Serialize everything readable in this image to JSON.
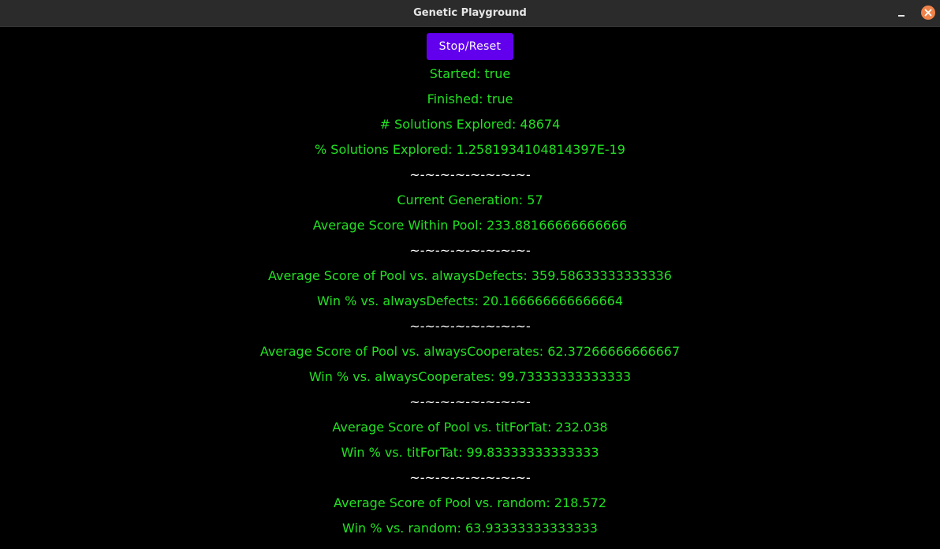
{
  "window": {
    "title": "Genetic Playground"
  },
  "controls": {
    "stop_reset_label": "Stop/Reset"
  },
  "status": {
    "started": "Started: true",
    "finished": "Finished: true",
    "solutions_explored": "# Solutions Explored: 48674",
    "percent_explored": "% Solutions Explored: 1.2581934104814397E-19"
  },
  "separator": "~-~-~-~-~-~-~-~-",
  "generation": {
    "current": "Current Generation: 57",
    "avg_within_pool": "Average Score Within Pool: 233.88166666666666"
  },
  "matchups": [
    {
      "avg_score": "Average Score of Pool vs. alwaysDefects: 359.58633333333336",
      "win_pct": "Win % vs. alwaysDefects: 20.166666666666664"
    },
    {
      "avg_score": "Average Score of Pool vs. alwaysCooperates: 62.37266666666667",
      "win_pct": "Win % vs. alwaysCooperates: 99.73333333333333"
    },
    {
      "avg_score": "Average Score of Pool vs. titForTat: 232.038",
      "win_pct": "Win % vs. titForTat: 99.83333333333333"
    },
    {
      "avg_score": "Average Score of Pool vs. random: 218.572",
      "win_pct": "Win % vs. random: 63.93333333333333"
    }
  ],
  "colors": {
    "background": "#000000",
    "text_green": "#22e022",
    "separator_white": "#ffffff",
    "button_purple": "#6200ee",
    "close_button_orange": "#f0834a"
  },
  "icons": {
    "minimize": "minimize-icon",
    "close": "close-icon"
  }
}
